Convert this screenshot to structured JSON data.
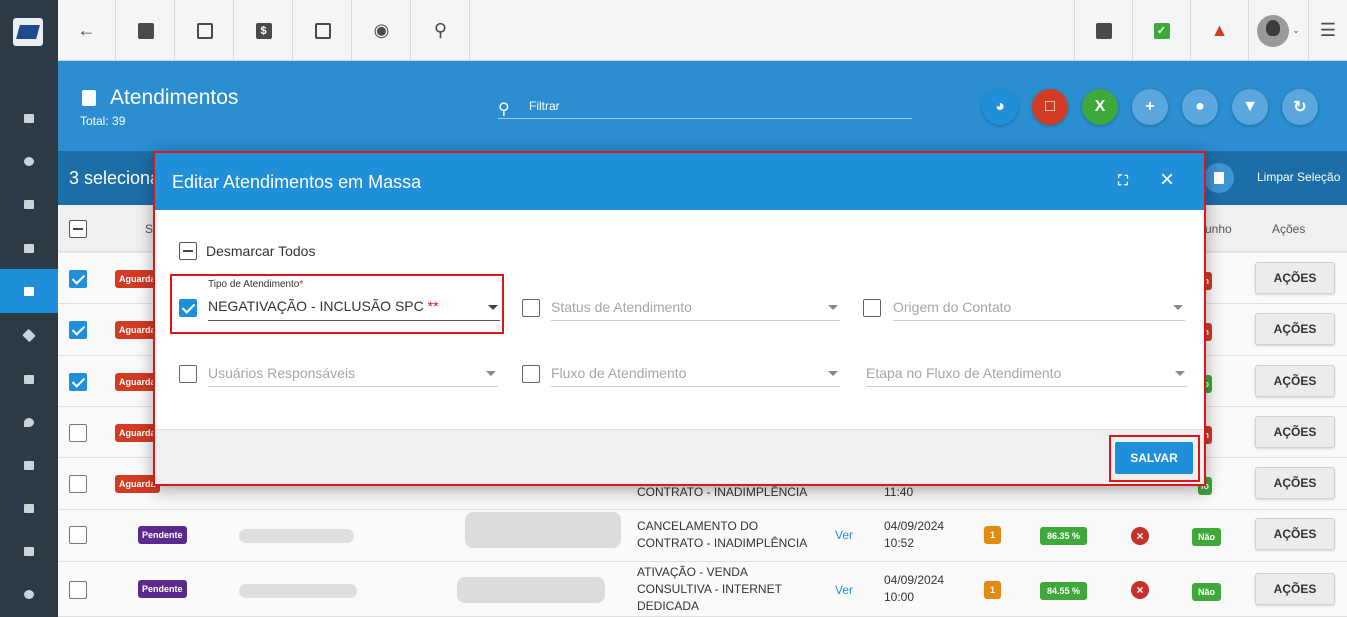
{
  "header": {
    "title": "Atendimentos",
    "total": "Total: 39",
    "filter_placeholder": "Filtrar"
  },
  "selection": {
    "text": "3 seleciona",
    "clear_label": "Limpar Seleção"
  },
  "table": {
    "headers": [
      "St",
      "unho",
      "Ações"
    ],
    "rows": [
      {
        "checked": true,
        "status": "Aguarda",
        "tail_badge": "m",
        "action": "AÇÕES"
      },
      {
        "checked": true,
        "status": "Aguarda",
        "tail_badge": "m",
        "action": "AÇÕES"
      },
      {
        "checked": true,
        "status": "Aguarda",
        "tail_badge": "io",
        "action": "AÇÕES"
      },
      {
        "checked": false,
        "status": "Aguarda",
        "tail_badge": "m",
        "action": "AÇÕES"
      },
      {
        "checked": false,
        "status": "Aguarda",
        "peek_type": "CONTRATO - INADIMPLÊNCIA",
        "peek_time": "11:40",
        "tail_badge": "io",
        "action": "AÇÕES"
      },
      {
        "checked": false,
        "status": "Pendente",
        "type_line1": "CANCELAMENTO DO",
        "type_line2": "CONTRATO - INADIMPLÊNCIA",
        "link": "Ver",
        "date": "04/09/2024",
        "time": "10:52",
        "count": "1",
        "percent": "86.35 %",
        "flag": "Não",
        "action": "AÇÕES"
      },
      {
        "checked": false,
        "status": "Pendente",
        "type_line1": "ATIVAÇÃO - VENDA",
        "type_line2": "CONSULTIVA - INTERNET",
        "type_line3": "DEDICADA",
        "link": "Ver",
        "date": "04/09/2024",
        "time": "10:00",
        "count": "1",
        "percent": "84.55 %",
        "flag": "Não",
        "action": "AÇÕES"
      }
    ]
  },
  "modal": {
    "title": "Editar Atendimentos em Massa",
    "unselect_all": "Desmarcar Todos",
    "fields": {
      "tipo": {
        "label": "Tipo de Atendimento",
        "required_mark": "*",
        "value": "NEGATIVAÇÃO - INCLUSÃO SPC",
        "value_mark": "**",
        "checked": true
      },
      "status": {
        "placeholder": "Status de Atendimento",
        "checked": false
      },
      "origem": {
        "placeholder": "Origem do Contato",
        "checked": false
      },
      "usuarios": {
        "placeholder": "Usuários Responsáveis",
        "checked": false
      },
      "fluxo": {
        "placeholder": "Fluxo de Atendimento",
        "checked": false
      },
      "etapa": {
        "placeholder": "Etapa no Fluxo de Atendimento"
      }
    },
    "save_label": "SALVAR"
  },
  "colors": {
    "primary": "#1f8fd9",
    "header_blue": "#2a8ed0",
    "selection_blue": "#1c6ea7",
    "sidebar": "#2b3a44",
    "highlight_red": "#e0151b",
    "badge_red": "#d23b24",
    "badge_purple": "#5b2a8e",
    "badge_green": "#3ea83b",
    "badge_orange": "#e08a10"
  }
}
